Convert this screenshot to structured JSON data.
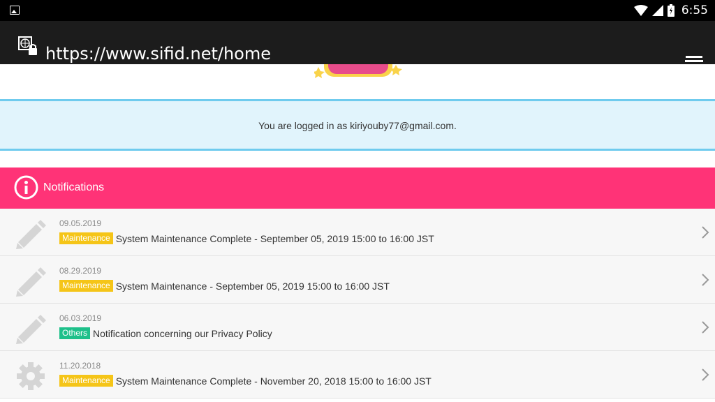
{
  "status_bar": {
    "time": "6:55",
    "icons": [
      "image-notification-icon",
      "wifi-icon",
      "signal-icon",
      "battery-icon"
    ]
  },
  "browser": {
    "url": "https://www.sifid.net/home",
    "icons": [
      "secure-lock-icon",
      "tabs-icon"
    ]
  },
  "login": {
    "text": "You are logged in as kiriyouby77@gmail.com."
  },
  "notifications": {
    "title": "Notifications",
    "items": [
      {
        "date": "09.05.2019",
        "tag": "Maintenance",
        "text": "System Maintenance Complete - September 05, 2019 15:00 to 16:00 JST",
        "icon": "pencil-icon"
      },
      {
        "date": "08.29.2019",
        "tag": "Maintenance",
        "text": "System Maintenance - September 05, 2019 15:00 to 16:00 JST",
        "icon": "pencil-icon"
      },
      {
        "date": "06.03.2019",
        "tag": "Others",
        "text": "Notification concerning our Privacy Policy",
        "icon": "pencil-icon"
      },
      {
        "date": "11.20.2018",
        "tag": "Maintenance",
        "text": "System Maintenance Complete - November 20, 2018 15:00 to 16:00 JST",
        "icon": "gear-icon"
      }
    ]
  },
  "colors": {
    "notif_header": "#ff3377",
    "login_bg": "#e1f4fc",
    "login_border": "#6fcbee",
    "tag_maintenance": "#f5c518",
    "tag_others": "#1ec08a"
  }
}
